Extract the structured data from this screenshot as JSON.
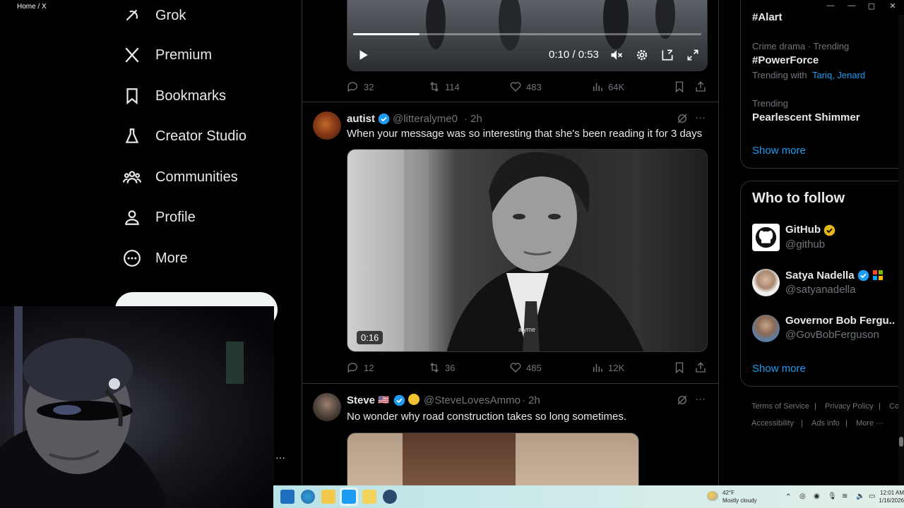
{
  "window": {
    "title": "Home / X",
    "minimize": "—",
    "maximize": "▢",
    "close": "✕"
  },
  "nav": {
    "items": [
      {
        "label": "Grok",
        "icon": "grok-icon"
      },
      {
        "label": "Premium",
        "icon": "x-logo-icon"
      },
      {
        "label": "Bookmarks",
        "icon": "bookmark-icon"
      },
      {
        "label": "Creator Studio",
        "icon": "flask-icon"
      },
      {
        "label": "Communities",
        "icon": "communities-icon"
      },
      {
        "label": "Profile",
        "icon": "profile-icon"
      },
      {
        "label": "More",
        "icon": "more-circle-icon"
      }
    ],
    "more_dots": "···"
  },
  "feed": {
    "tweet0": {
      "video_time": "0:10 / 0:53",
      "progress": 0.19,
      "replies": "32",
      "reposts": "114",
      "likes": "483",
      "views": "64K"
    },
    "tweet1": {
      "name": "autist",
      "handle": "@litteralyme0",
      "time": "· 2h",
      "text": "When your message was so interesting that she's been reading it for 3 days",
      "video_duration": "0:16",
      "watermark": "alyme",
      "replies": "12",
      "reposts": "36",
      "likes": "485",
      "views": "12K"
    },
    "tweet2": {
      "name": "Steve",
      "flag": "🇺🇸",
      "emoji": "🟡",
      "handle": "@SteveLovesAmmo",
      "time": "· 2h",
      "text": "No wonder why road construction takes so long sometimes."
    }
  },
  "trends": {
    "top_partial": "#Alart",
    "items": [
      {
        "meta": "Crime drama · Trending",
        "topic": "#PowerForce",
        "with_label": "Trending with",
        "with_links": "Tariq, Jenard"
      },
      {
        "meta": "Trending",
        "topic": "Pearlescent Shimmer"
      }
    ],
    "show_more": "Show more"
  },
  "who_to_follow": {
    "title": "Who to follow",
    "accounts": [
      {
        "name": "GitHub",
        "handle": "@github",
        "badge": "gold"
      },
      {
        "name": "Satya Nadella",
        "handle": "@satyanadella",
        "badge": "blue"
      },
      {
        "name": "Governor Bob Fergu...",
        "handle": "@GovBobFerguson",
        "badge": "none"
      }
    ],
    "show_more": "Show more"
  },
  "footer": {
    "links": [
      "Terms of Service",
      "|",
      "Privacy Policy",
      "|",
      "Co"
    ],
    "links2": [
      "Accessibility",
      "|",
      "Ads info",
      "|",
      "More ···"
    ]
  },
  "taskbar": {
    "weather_temp": "42°F",
    "weather_desc": "Mostly cloudy",
    "time": "12:01 AM",
    "date": "1/16/2026"
  },
  "colors": {
    "accent": "#1d9bf0",
    "like": "#71767b",
    "verified_gold": "#e2b719"
  }
}
